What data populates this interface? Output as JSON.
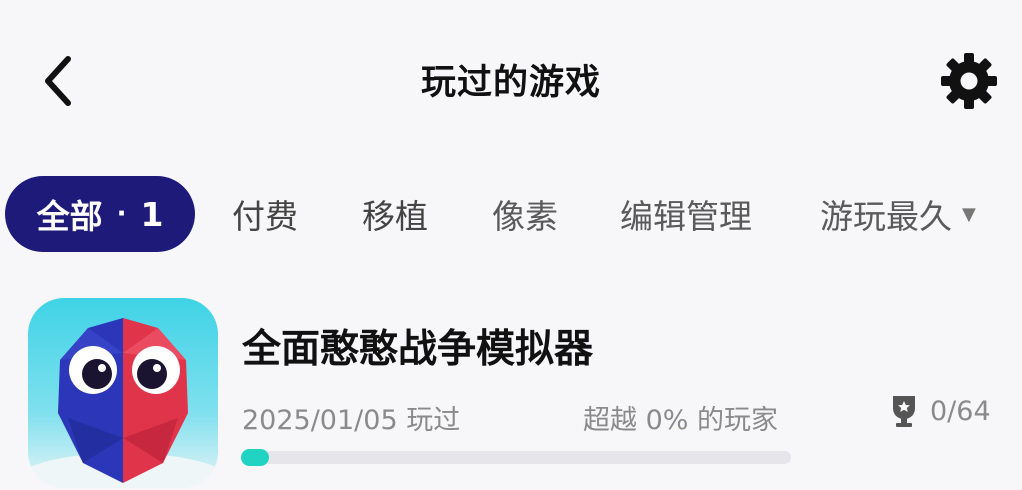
{
  "header": {
    "title": "玩过的游戏",
    "back_icon": "chevron-left-icon",
    "settings_icon": "gear-icon"
  },
  "tabs": {
    "active": {
      "label": "全部",
      "count": "1"
    },
    "items": [
      {
        "label": "付费"
      },
      {
        "label": "移植"
      },
      {
        "label": "像素"
      },
      {
        "label": "编辑管理"
      }
    ],
    "sort": {
      "label": "游玩最久",
      "icon": "caret-down-icon"
    }
  },
  "games": [
    {
      "title": "全面憨憨战争模拟器",
      "played": "2025/01/05 玩过",
      "surpass": "超越 0% 的玩家",
      "achievements": "0/64",
      "progress": 0.03
    }
  ],
  "colors": {
    "active_tab_bg": "#1e1a7a",
    "progress_fill": "#20d3c2",
    "progress_track": "#e6e6ea",
    "background": "#f7f7f9"
  }
}
